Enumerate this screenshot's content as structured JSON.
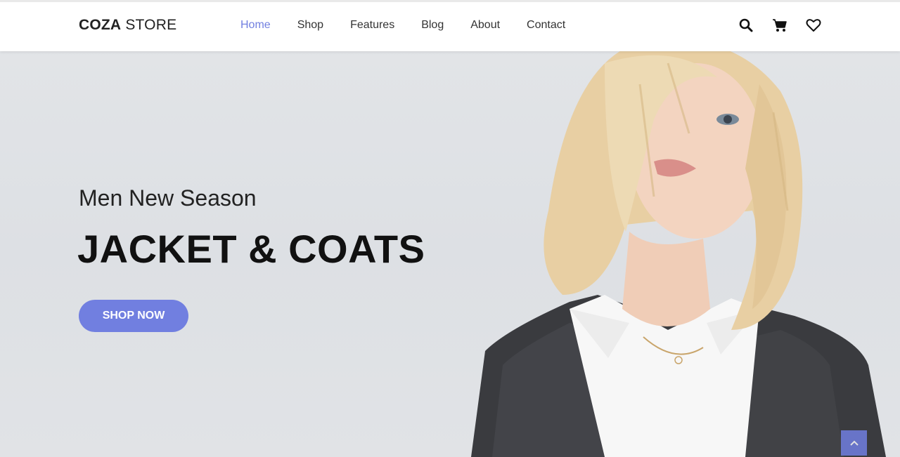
{
  "brand": {
    "name_bold": "COZA",
    "name_light": " STORE"
  },
  "nav": {
    "items": [
      {
        "label": "Home",
        "active": true
      },
      {
        "label": "Shop",
        "active": false
      },
      {
        "label": "Features",
        "active": false
      },
      {
        "label": "Blog",
        "active": false
      },
      {
        "label": "About",
        "active": false
      },
      {
        "label": "Contact",
        "active": false
      }
    ]
  },
  "header_icons": [
    "search-icon",
    "cart-icon",
    "heart-icon"
  ],
  "hero": {
    "subtitle": "Men New Season",
    "title": "JACKET & COATS",
    "button_label": "SHOP NOW"
  },
  "back_to_top_icon": "chevron-up-icon",
  "colors": {
    "accent": "#717fe0",
    "text": "#222222",
    "hero_bg": "#e0e2e5"
  }
}
